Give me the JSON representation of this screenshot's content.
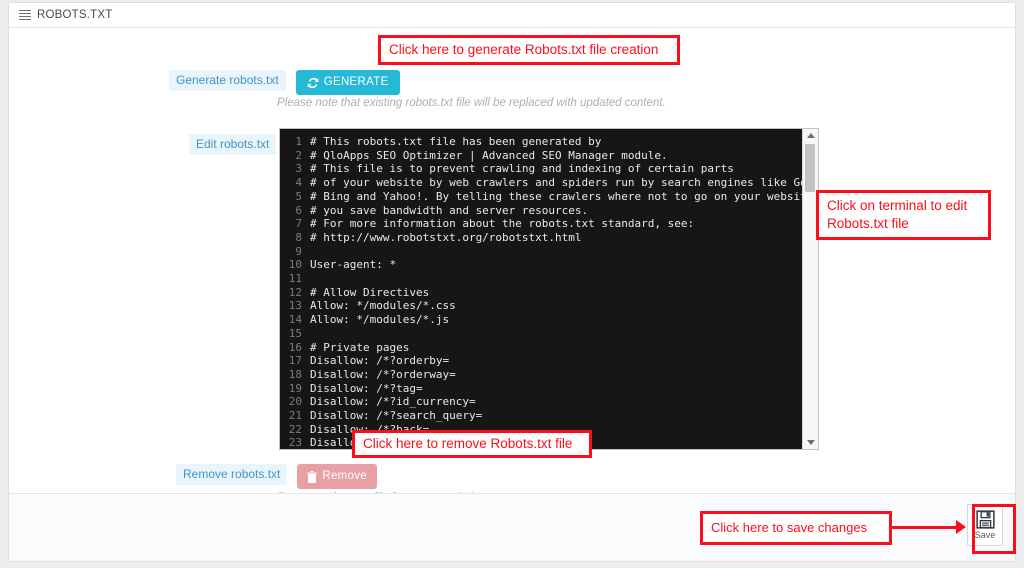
{
  "header": {
    "title": "ROBOTS.TXT",
    "icon": "list-lines-icon"
  },
  "generate_section": {
    "label": "Generate robots.txt",
    "button_label": "GENERATE",
    "button_icon": "refresh-icon",
    "button_color": "#25b9d7",
    "hint": "Please note that existing robots.txt file will be replaced with updated content."
  },
  "edit_section": {
    "label": "Edit robots.txt"
  },
  "remove_section": {
    "label": "Remove robots.txt",
    "button_label": "Remove",
    "button_icon": "trash-icon",
    "button_color": "#e8a0a5",
    "hint": "Remove robots.txt file from your website."
  },
  "footer": {
    "save_label": "Save",
    "save_icon": "floppy-disk-icon"
  },
  "terminal": {
    "lines": [
      {
        "num": "1",
        "text": "# This robots.txt file has been generated by"
      },
      {
        "num": "2",
        "text": "# QloApps SEO Optimizer | Advanced SEO Manager module."
      },
      {
        "num": "3",
        "text": "# This file is to prevent crawling and indexing of certain parts"
      },
      {
        "num": "4",
        "text": "# of your website by web crawlers and spiders run by search engines like Google"
      },
      {
        "num": "5",
        "text": "# Bing and Yahoo!. By telling these crawlers where not to go on your website,"
      },
      {
        "num": "6",
        "text": "# you save bandwidth and server resources."
      },
      {
        "num": "7",
        "text": "# For more information about the robots.txt standard, see:"
      },
      {
        "num": "8",
        "text": "# http://www.robotstxt.org/robotstxt.html"
      },
      {
        "num": "9",
        "text": ""
      },
      {
        "num": "10",
        "text": "User-agent: *"
      },
      {
        "num": "11",
        "text": ""
      },
      {
        "num": "12",
        "text": "# Allow Directives"
      },
      {
        "num": "13",
        "text": "Allow: */modules/*.css"
      },
      {
        "num": "14",
        "text": "Allow: */modules/*.js"
      },
      {
        "num": "15",
        "text": ""
      },
      {
        "num": "16",
        "text": "# Private pages"
      },
      {
        "num": "17",
        "text": "Disallow: /*?orderby="
      },
      {
        "num": "18",
        "text": "Disallow: /*?orderway="
      },
      {
        "num": "19",
        "text": "Disallow: /*?tag="
      },
      {
        "num": "20",
        "text": "Disallow: /*?id_currency="
      },
      {
        "num": "21",
        "text": "Disallow: /*?search_query="
      },
      {
        "num": "22",
        "text": "Disallow: /*?back="
      },
      {
        "num": "23",
        "text": "Disallow: /*?n="
      }
    ]
  },
  "annotations": {
    "generate": "Click here to generate Robots.txt file creation",
    "terminal_line1": "Click on terminal to edit",
    "terminal_line2": "Robots.txt file",
    "remove": "Click here to remove Robots.txt file",
    "save": "Click here to save changes",
    "color": "#fc0d1b"
  }
}
